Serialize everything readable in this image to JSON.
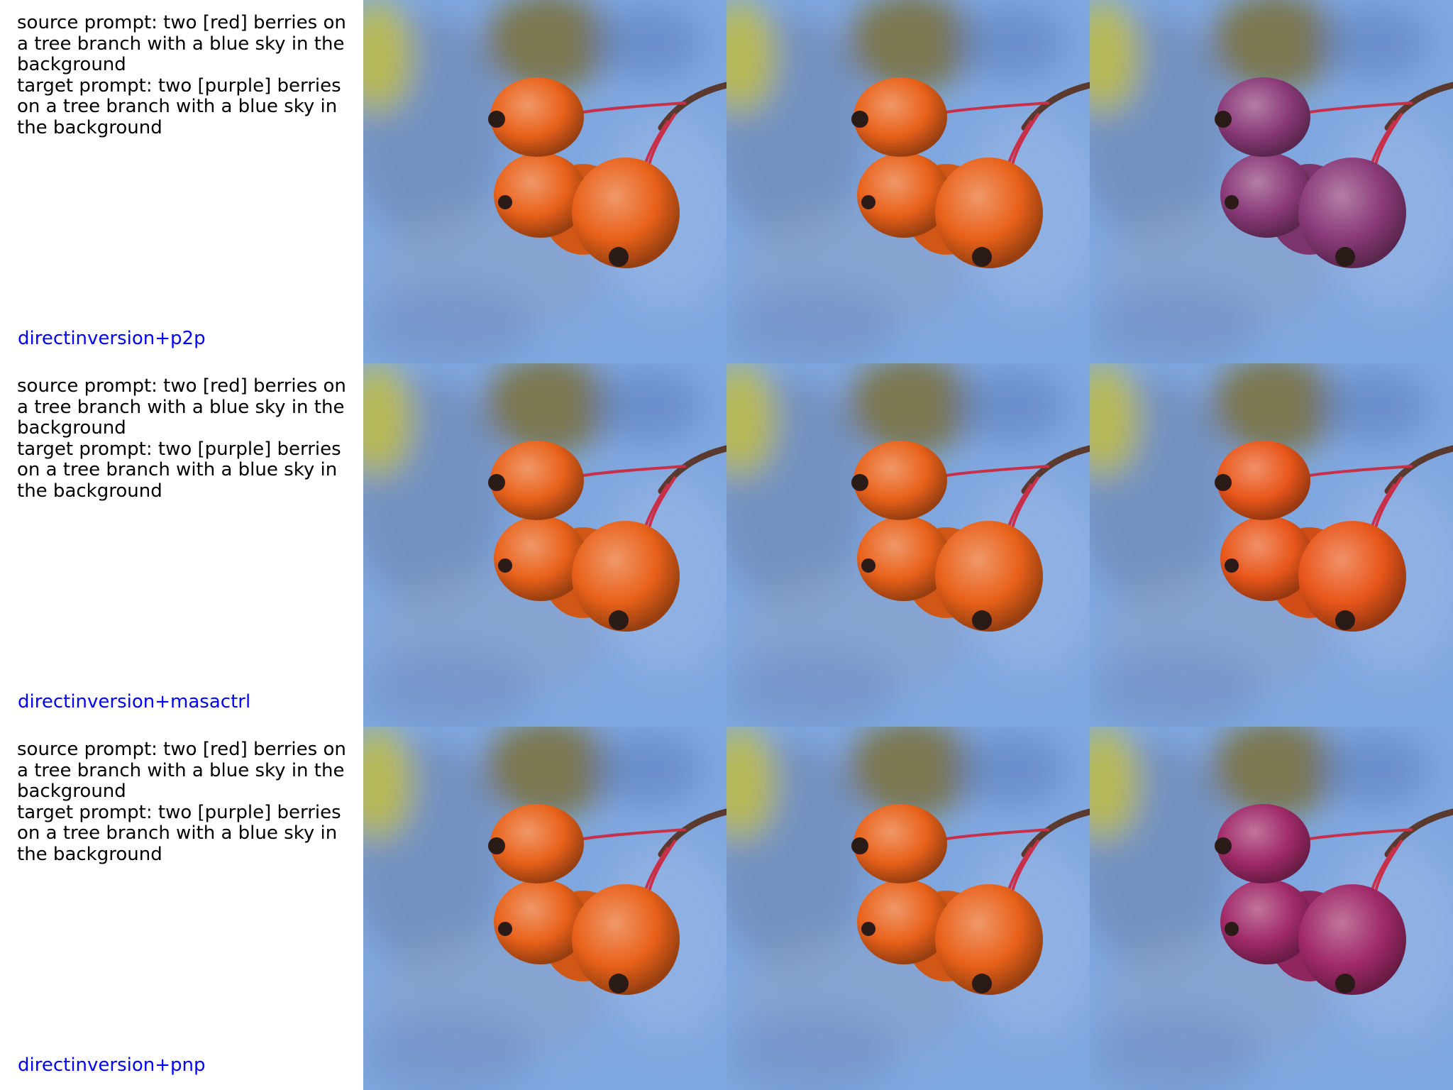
{
  "rows": [
    {
      "source_prompt": "source prompt: two [red] berries on a tree branch with a blue sky in the background",
      "target_prompt": "target prompt: two [purple] berries on a tree branch with a blue sky in the background",
      "method": "directinversion+p2p",
      "images": [
        {
          "alt": "source image: two red-orange berries on a branch against blurred blue sky",
          "berry_color": "#e8611a"
        },
        {
          "alt": "reconstruction: two red-orange berries on a branch against blurred blue sky",
          "berry_color": "#e8611a"
        },
        {
          "alt": "edited image: two purple berries on a branch against blurred blue sky",
          "berry_color": "#8a3a78"
        }
      ]
    },
    {
      "source_prompt": "source prompt: two [red] berries on a tree branch with a blue sky in the background",
      "target_prompt": "target prompt: two [purple] berries on a tree branch with a blue sky in the background",
      "method": "directinversion+masactrl",
      "images": [
        {
          "alt": "source image: two red-orange berries on a branch against blurred blue sky",
          "berry_color": "#e8611a"
        },
        {
          "alt": "reconstruction: two red-orange berries on a branch against blurred blue sky",
          "berry_color": "#e8611a"
        },
        {
          "alt": "edited image: berries remain red-orange on a branch against blurred blue sky",
          "berry_color": "#e8561a"
        }
      ]
    },
    {
      "source_prompt": "source prompt: two [red] berries on a tree branch with a blue sky in the background",
      "target_prompt": "target prompt: two [purple] berries on a tree branch with a blue sky in the background",
      "method": "directinversion+pnp",
      "images": [
        {
          "alt": "source image: two red-orange berries on a branch against blurred blue sky",
          "berry_color": "#e8611a"
        },
        {
          "alt": "reconstruction: two red-orange berries on a branch against blurred blue sky",
          "berry_color": "#e8611a"
        },
        {
          "alt": "edited image: two magenta-purple berries on a branch against blurred blue sky",
          "berry_color": "#a02a68"
        }
      ]
    }
  ],
  "colors": {
    "caption_text": "#000000",
    "method_label": "#0000ff",
    "sky": "#7fa7df",
    "branch": "#5a3a2e",
    "stem": "#c8304a"
  }
}
